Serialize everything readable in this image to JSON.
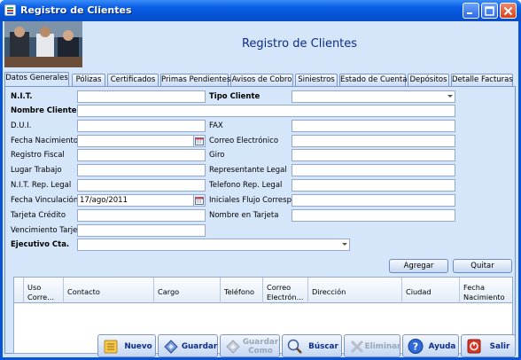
{
  "window": {
    "title": "Registro de Clientes"
  },
  "header": {
    "title": "Registro de Clientes"
  },
  "tabs": [
    "Datos Generales",
    "Pólizas",
    "Certificados",
    "Primas Pendientes",
    "Avisos de Cobro",
    "Siniestros",
    "Estado de Cuenta",
    "Depósitos",
    "Detalle Facturas"
  ],
  "form": {
    "nit": {
      "label": "N.I.T.",
      "value": ""
    },
    "tipo_cliente": {
      "label": "Tipo Cliente",
      "value": ""
    },
    "nombre_cliente": {
      "label": "Nombre Cliente",
      "value": ""
    },
    "dui": {
      "label": "D.U.I.",
      "value": ""
    },
    "fax": {
      "label": "FAX",
      "value": ""
    },
    "fecha_nacimiento": {
      "label": "Fecha Nacimiento",
      "value": ""
    },
    "correo": {
      "label": "Correo Electrónico",
      "value": ""
    },
    "registro_fiscal": {
      "label": "Registro Fiscal",
      "value": ""
    },
    "giro": {
      "label": "Giro",
      "value": ""
    },
    "lugar_trabajo": {
      "label": "Lugar Trabajo",
      "value": ""
    },
    "representante_legal": {
      "label": "Representante Legal",
      "value": ""
    },
    "nit_rep_legal": {
      "label": "N.I.T. Rep. Legal",
      "value": ""
    },
    "telefono_rep_legal": {
      "label": "Telefono Rep. Legal",
      "value": ""
    },
    "fecha_vinculacion": {
      "label": "Fecha Vinculación",
      "value": "17/ago/2011"
    },
    "iniciales_flujo": {
      "label": "Iniciales Flujo Corresp.",
      "value": ""
    },
    "tarjeta_credito": {
      "label": "Tarjeta Crédito",
      "value": ""
    },
    "nombre_tarjeta": {
      "label": "Nombre en Tarjeta",
      "value": ""
    },
    "vencimiento_tarjeta": {
      "label": "Vencimiento Tarjeta",
      "value": ""
    },
    "ejecutivo": {
      "label": "Ejecutivo Cta.",
      "value": ""
    }
  },
  "contacts": {
    "agregar": "Agregar",
    "quitar": "Quitar",
    "columns": [
      "Uso Corre...",
      "Contacto",
      "Cargo",
      "Teléfono",
      "Correo Electrón...",
      "Dirección",
      "Ciudad",
      "Fecha Nacimiento"
    ]
  },
  "toolbar": {
    "nuevo": "Nuevo",
    "guardar": "Guardar",
    "guardar_como": "Guardar Como",
    "buscar": "Búscar",
    "eliminar": "Eliminar",
    "ayuda": "Ayuda",
    "salir": "Salir"
  },
  "colors": {
    "title_bar": "#0a5ee6",
    "client_bg": "#d6e6fa",
    "header_text": "#0c2c8c"
  }
}
